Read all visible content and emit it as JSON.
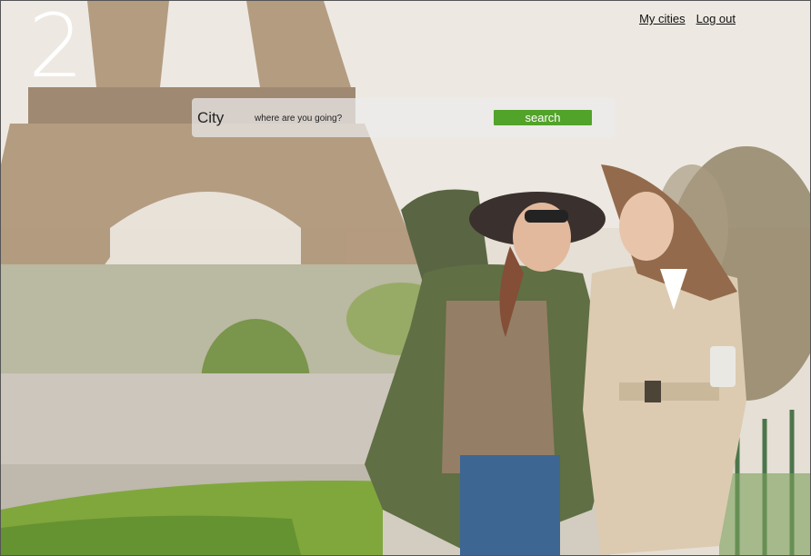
{
  "brand": {
    "logo_text": "2"
  },
  "nav": {
    "items": [
      {
        "label": "My cities"
      },
      {
        "label": "Log out"
      }
    ]
  },
  "search": {
    "label": "City",
    "placeholder": "where are you going?",
    "button_label": "search"
  },
  "hero": {
    "description": ""
  },
  "colors": {
    "accent": "#52a329",
    "overlay": "#ebebeb"
  }
}
